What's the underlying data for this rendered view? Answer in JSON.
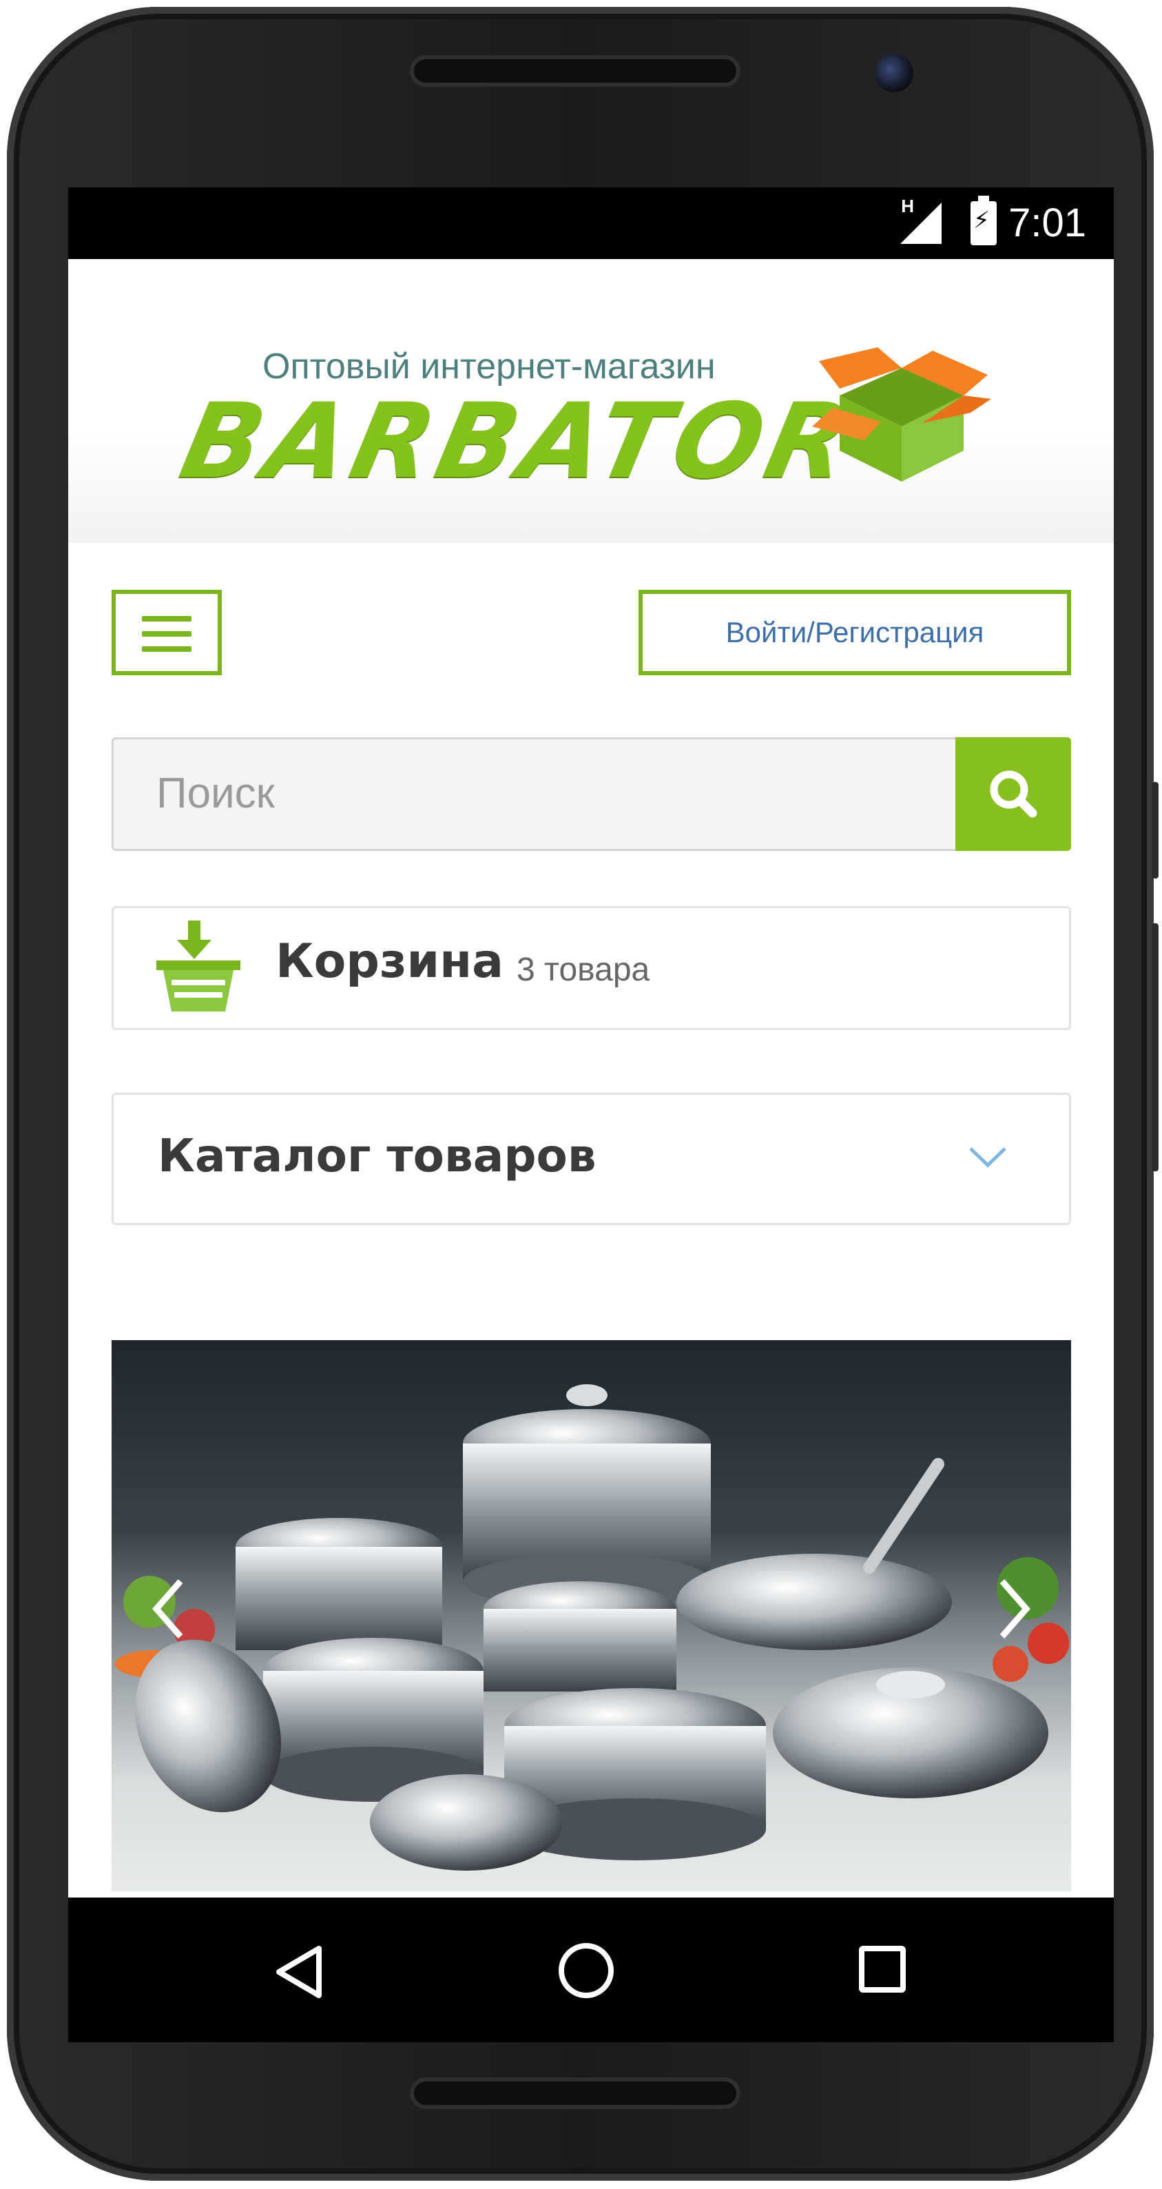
{
  "status_bar": {
    "time": "7:01",
    "network_label": "H",
    "icons": [
      "signal-icon",
      "battery-charging-icon"
    ]
  },
  "header": {
    "logo_subtitle": "Оптовый интернет-магазин",
    "logo_name": "BARBATOR",
    "logo_icon": "open-box-icon"
  },
  "toolbar": {
    "menu_icon": "hamburger-menu-icon",
    "login_label": "Войти/Регистрация"
  },
  "search": {
    "placeholder": "Поиск",
    "button_icon": "search-icon"
  },
  "cart": {
    "icon": "basket-icon",
    "title": "Корзина",
    "count_text": "3 товара"
  },
  "catalog": {
    "title": "Каталог товаров",
    "expand_icon": "chevron-down-icon"
  },
  "banner": {
    "image_subject": "stainless steel cookware set",
    "prev_icon": "chevron-left-icon",
    "next_icon": "chevron-right-icon"
  },
  "nav_bar": {
    "icons": [
      "back-icon",
      "home-icon",
      "recent-apps-icon"
    ]
  },
  "colors": {
    "accent_green": "#86c21c",
    "link_blue": "#3d6fa8",
    "logo_orange": "#f5801f"
  }
}
